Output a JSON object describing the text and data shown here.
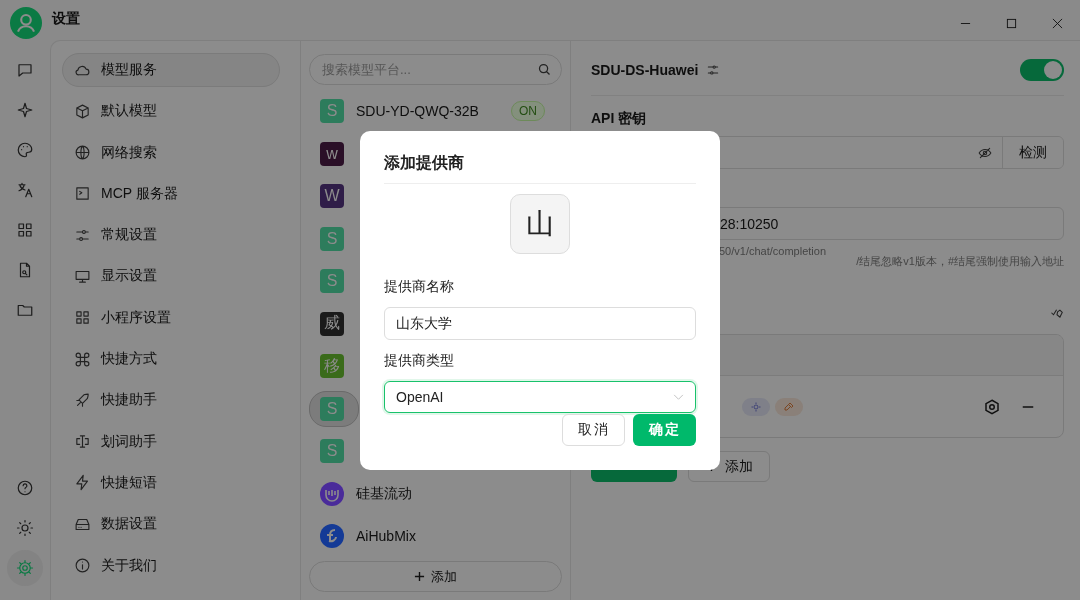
{
  "window": {
    "title": "设置"
  },
  "rail": {
    "top": [
      {
        "selected": false
      },
      {
        "selected": false
      },
      {
        "selected": false
      },
      {
        "selected": false
      },
      {
        "selected": false
      },
      {
        "selected": false
      },
      {
        "selected": false
      }
    ],
    "bottom": [
      {
        "selected": false
      },
      {
        "selected": false
      },
      {
        "selected": true
      }
    ]
  },
  "menu": [
    {
      "label": "模型服务",
      "selected": true
    },
    {
      "label": "默认模型",
      "selected": false
    },
    {
      "label": "网络搜索",
      "selected": false
    },
    {
      "label": "MCP 服务器",
      "selected": false
    },
    {
      "label": "常规设置",
      "selected": false
    },
    {
      "label": "显示设置",
      "selected": false
    },
    {
      "label": "小程序设置",
      "selected": false
    },
    {
      "label": "快捷方式",
      "selected": false
    },
    {
      "label": "快捷助手",
      "selected": false
    },
    {
      "label": "划词助手",
      "selected": false
    },
    {
      "label": "快捷短语",
      "selected": false
    },
    {
      "label": "数据设置",
      "selected": false
    },
    {
      "label": "关于我们",
      "selected": false
    }
  ],
  "providers": {
    "search": {
      "placeholder": "搜索模型平台..."
    },
    "items": [
      {
        "kind": "letter",
        "mark": "S",
        "color": "#2d7c5c",
        "label": "SDU-YD-QWQ-32B",
        "badge": "ON",
        "selected": false
      },
      {
        "kind": "letter",
        "mark": "w",
        "color": "#2a0f27",
        "selected": false
      },
      {
        "kind": "letter",
        "mark": "W",
        "color": "#2f1d48",
        "selected": false
      },
      {
        "kind": "letter",
        "mark": "S",
        "color": "#2d7c5c",
        "selected": false
      },
      {
        "kind": "letter",
        "mark": "S",
        "color": "#2d7c5c",
        "selected": false
      },
      {
        "kind": "letter",
        "mark": "威",
        "color": "#1a1a1a",
        "selected": false
      },
      {
        "kind": "letter",
        "mark": "移",
        "color": "#3a6b1a",
        "selected": false
      },
      {
        "kind": "letter",
        "mark": "S",
        "color": "#2d7c5c",
        "selected": true
      },
      {
        "kind": "letter",
        "mark": "S",
        "color": "#2d7c5c",
        "selected": false
      },
      {
        "kind": "logo",
        "color": "#4a2b9a",
        "label": "硅基流动",
        "selected": false
      },
      {
        "kind": "logo",
        "color": "#143a96",
        "label": "AiHubMix",
        "selected": false
      }
    ],
    "add_button": "添加"
  },
  "detail": {
    "name": "SDU-DS-Huawei",
    "enabled": true,
    "api_key_label": "API 密钥",
    "check_button": "检测",
    "api_address": "28:10250",
    "hint_1": "50/v1/chat/completion",
    "hint_2": "/结尾忽略v1版本，#结尾强制使用输入地址",
    "add_button": "添加"
  },
  "dialog": {
    "title": "添加提供商",
    "logo": "山",
    "name_label": "提供商名称",
    "name_value": "山东大学",
    "type_label": "提供商类型",
    "type_value": "OpenAI",
    "buttons": [
      {
        "label": "取消",
        "kind": "secondary"
      },
      {
        "label": "确定",
        "kind": "primary"
      }
    ]
  }
}
